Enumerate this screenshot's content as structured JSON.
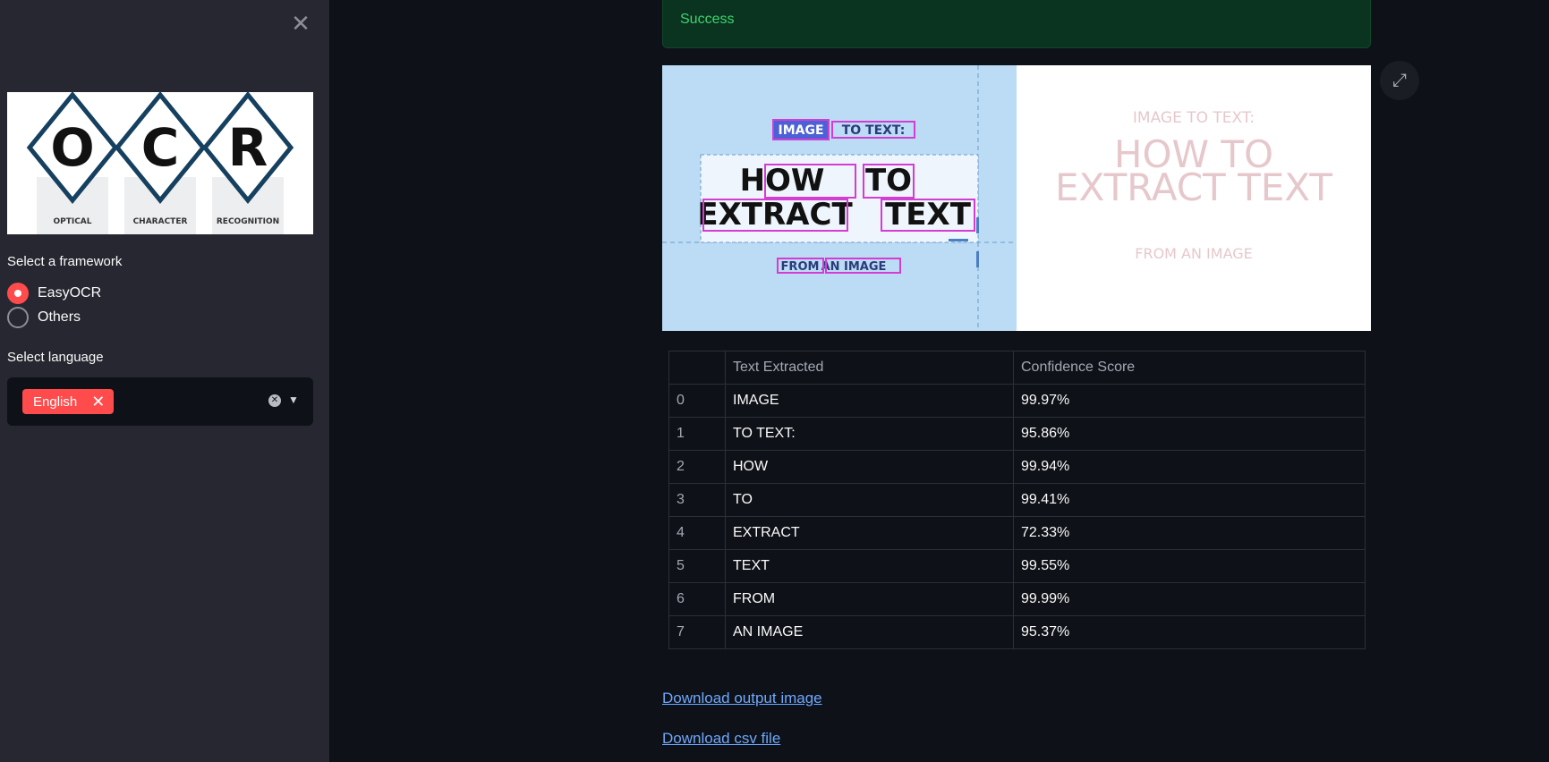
{
  "sidebar": {
    "logo": {
      "letters": [
        "O",
        "C",
        "R"
      ],
      "captions": [
        "OPTICAL",
        "CHARACTER",
        "RECOGNITION"
      ]
    },
    "framework_label": "Select a framework",
    "frameworks": [
      {
        "label": "EasyOCR",
        "selected": true
      },
      {
        "label": "Others",
        "selected": false
      }
    ],
    "language_label": "Select language",
    "languages": [
      "English"
    ]
  },
  "status": {
    "message": "Success"
  },
  "preview": {
    "left_words": [
      "IMAGE",
      "TO TEXT:",
      "HOW",
      "TO",
      "EXTRACT",
      "TEXT",
      "FROM",
      "AN IMAGE"
    ],
    "right_lines": [
      "IMAGE TO TEXT:",
      "HOW TO",
      "EXTRACT TEXT",
      "FROM AN IMAGE"
    ]
  },
  "table": {
    "columns": [
      "",
      "Text Extracted",
      "Confidence Score"
    ],
    "rows": [
      {
        "idx": "0",
        "text": "IMAGE",
        "score": "99.97%"
      },
      {
        "idx": "1",
        "text": "TO TEXT:",
        "score": "95.86%"
      },
      {
        "idx": "2",
        "text": "HOW",
        "score": "99.94%"
      },
      {
        "idx": "3",
        "text": "TO",
        "score": "99.41%"
      },
      {
        "idx": "4",
        "text": "EXTRACT",
        "score": "72.33%"
      },
      {
        "idx": "5",
        "text": "TEXT",
        "score": "99.55%"
      },
      {
        "idx": "6",
        "text": "FROM",
        "score": "99.99%"
      },
      {
        "idx": "7",
        "text": "AN IMAGE",
        "score": "95.37%"
      }
    ]
  },
  "downloads": {
    "image_label": "Download output image",
    "csv_label": "Download csv file"
  },
  "colors": {
    "accent": "#ff4b4b",
    "success_bg": "#0a3320",
    "success_text": "#3dd56d",
    "link": "#6ea8fe",
    "bbox": "#d43cd4"
  }
}
